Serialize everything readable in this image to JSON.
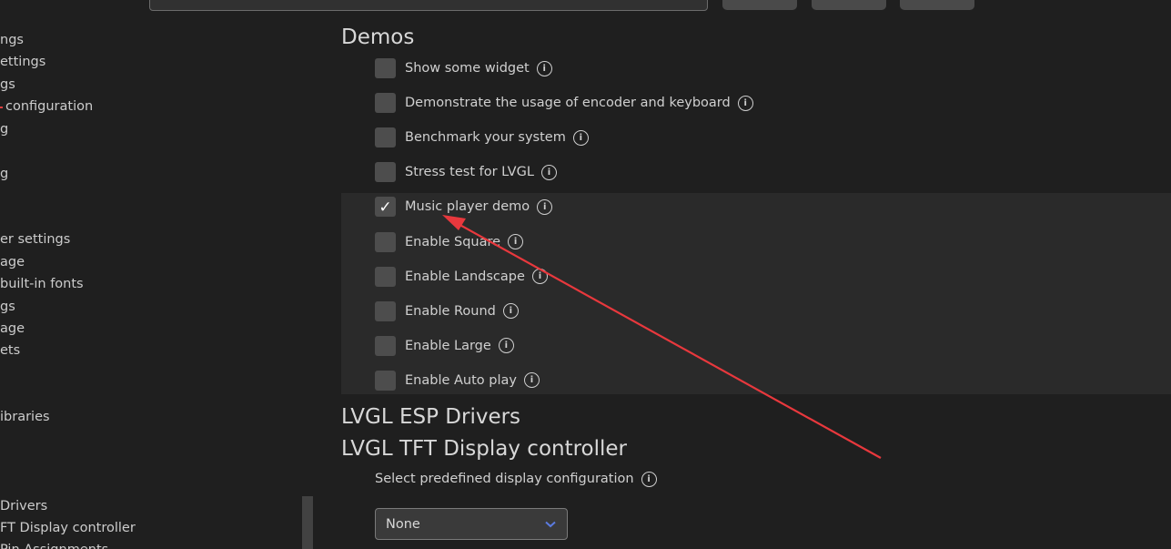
{
  "sidebar": {
    "items": [
      {
        "label": "ngs"
      },
      {
        "label": "ettings"
      },
      {
        "label": "gs"
      },
      {
        "label": "configuration"
      },
      {
        "label": "g"
      },
      {
        "label": "g"
      },
      {
        "label": "er settings"
      },
      {
        "label": "age"
      },
      {
        "label": "built-in fonts"
      },
      {
        "label": "gs"
      },
      {
        "label": "age"
      },
      {
        "label": "ets"
      },
      {
        "label": "ibraries"
      },
      {
        "label": "Drivers"
      },
      {
        "label": "FT Display controller"
      },
      {
        "label": "Pin Assignments"
      }
    ]
  },
  "demos": {
    "title": "Demos",
    "options": [
      {
        "label": "Show some widget",
        "checked": false
      },
      {
        "label": "Demonstrate the usage of encoder and keyboard",
        "checked": false
      },
      {
        "label": "Benchmark your system",
        "checked": false
      },
      {
        "label": "Stress test for LVGL",
        "checked": false
      },
      {
        "label": "Music player demo",
        "checked": true
      },
      {
        "label": "Enable Square",
        "checked": false
      },
      {
        "label": "Enable Landscape",
        "checked": false
      },
      {
        "label": "Enable Round",
        "checked": false
      },
      {
        "label": "Enable Large",
        "checked": false
      },
      {
        "label": "Enable Auto play",
        "checked": false
      }
    ]
  },
  "esp_drivers": {
    "title": "LVGL ESP Drivers"
  },
  "tft": {
    "title": "LVGL TFT Display controller",
    "select_label": "Select predefined display configuration",
    "select_value": "None"
  },
  "icons": {
    "info": "i",
    "check": "✓"
  },
  "colors": {
    "annotation_arrow": "#e8383d",
    "select_chevron": "#5b7be0"
  }
}
